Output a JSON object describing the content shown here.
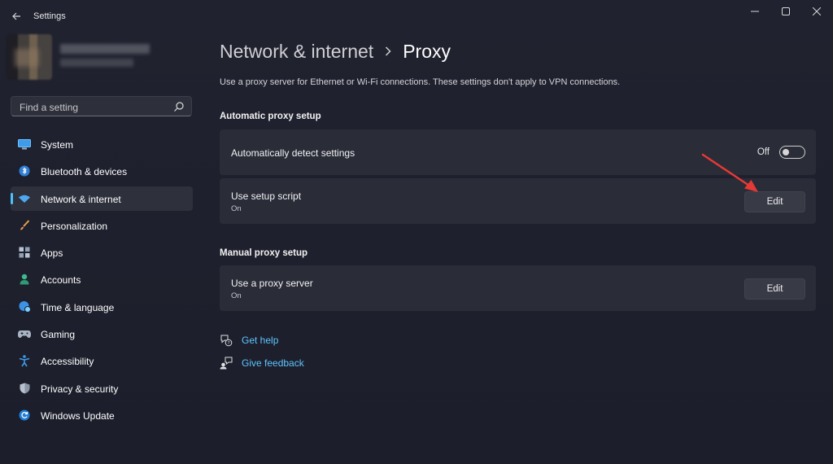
{
  "window": {
    "title": "Settings"
  },
  "search": {
    "placeholder": "Find a setting"
  },
  "sidebar": {
    "items": [
      {
        "label": "System",
        "icon": "monitor-icon"
      },
      {
        "label": "Bluetooth & devices",
        "icon": "bluetooth-icon"
      },
      {
        "label": "Network & internet",
        "icon": "wifi-icon",
        "active": true
      },
      {
        "label": "Personalization",
        "icon": "brush-icon"
      },
      {
        "label": "Apps",
        "icon": "apps-grid-icon"
      },
      {
        "label": "Accounts",
        "icon": "person-icon"
      },
      {
        "label": "Time & language",
        "icon": "globe-clock-icon"
      },
      {
        "label": "Gaming",
        "icon": "gamepad-icon"
      },
      {
        "label": "Accessibility",
        "icon": "accessibility-icon"
      },
      {
        "label": "Privacy & security",
        "icon": "shield-icon"
      },
      {
        "label": "Windows Update",
        "icon": "update-icon"
      }
    ]
  },
  "main": {
    "breadcrumb_parent": "Network & internet",
    "breadcrumb_current": "Proxy",
    "description": "Use a proxy server for Ethernet or Wi-Fi connections. These settings don't apply to VPN connections.",
    "automatic": {
      "title": "Automatic proxy setup",
      "detect": {
        "label": "Automatically detect settings",
        "state": "Off"
      },
      "script": {
        "label": "Use setup script",
        "status": "On",
        "button": "Edit"
      }
    },
    "manual": {
      "title": "Manual proxy setup",
      "proxy": {
        "label": "Use a proxy server",
        "status": "On",
        "button": "Edit"
      }
    },
    "links": {
      "help": "Get help",
      "feedback": "Give feedback"
    }
  },
  "colors": {
    "accent": "#4cc2ff",
    "background": "#1f2230",
    "card": "#2a2c38",
    "annotation_arrow": "#e53935"
  }
}
